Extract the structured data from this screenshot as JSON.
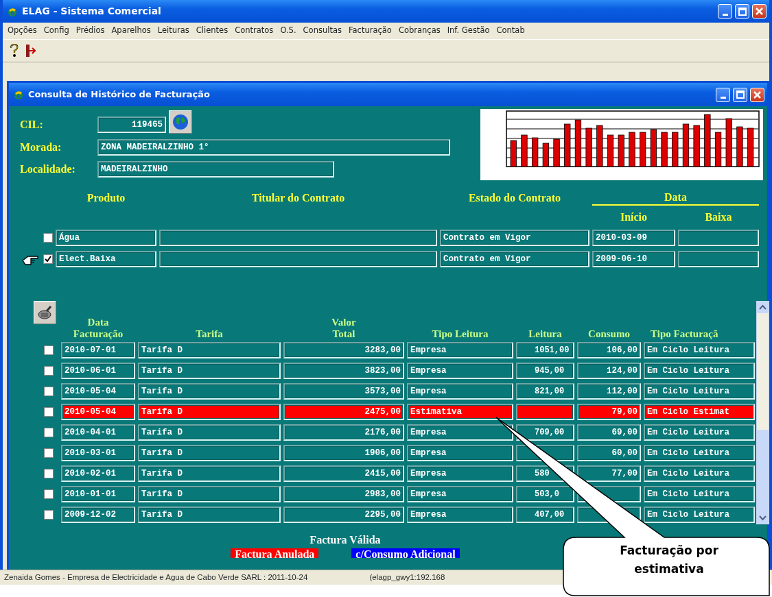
{
  "window": {
    "title": "ELAG - Sistema Comercial"
  },
  "menu": [
    "Opções",
    "Config",
    "Prédios",
    "Aparelhos",
    "Leituras",
    "Clientes",
    "Contratos",
    "O.S.",
    "Consultas",
    "Facturação",
    "Cobranças",
    "Inf. Gestão",
    "Contab"
  ],
  "child_window": {
    "title": "Consulta de Histórico de Facturação",
    "fields": [
      {
        "label": "CIL:",
        "value": "119465"
      },
      {
        "label": "Morada:",
        "value": "ZONA MADEIRALZINHO 1°"
      },
      {
        "label": "Localidade:",
        "value": "MADEIRALZINHO"
      }
    ],
    "contracts": {
      "columns": [
        "Produto",
        "Titular do Contrato",
        "Estado do Contrato"
      ],
      "date_group": "Data",
      "date_columns": [
        "Início",
        "Baixa"
      ],
      "rows": [
        {
          "checked": false,
          "pointer": false,
          "product": "Água",
          "state": "Contrato em Vigor",
          "start": "2010-03-09"
        },
        {
          "checked": true,
          "pointer": true,
          "product": "Elect.Baixa",
          "state": "Contrato em Vigor",
          "start": "2009-06-10"
        }
      ]
    },
    "billing": {
      "columns": [
        "Data\nFacturação",
        "Tarifa",
        "Valor\nTotal",
        "Tipo Leitura",
        "Leitura",
        "Consumo",
        "Tipo Facturaçã"
      ],
      "rows": [
        {
          "checked": false,
          "kind": "valid",
          "date": "2010-07-01",
          "tariff": "Tarifa D",
          "total": "3283,00",
          "reading_type": "Empresa",
          "reading": "1051,00",
          "consumption": "106,00",
          "billing_type": "Em Ciclo Leitura"
        },
        {
          "checked": false,
          "kind": "valid",
          "date": "2010-06-01",
          "tariff": "Tarifa D",
          "total": "3823,00",
          "reading_type": "Empresa",
          "reading": "945,00",
          "consumption": "124,00",
          "billing_type": "Em Ciclo Leitura"
        },
        {
          "checked": false,
          "kind": "valid",
          "date": "2010-05-04",
          "tariff": "Tarifa D",
          "total": "3573,00",
          "reading_type": "Empresa",
          "reading": "821,00",
          "consumption": "112,00",
          "billing_type": "Em Ciclo Leitura"
        },
        {
          "checked": false,
          "kind": "annulled",
          "date": "2010-05-04",
          "tariff": "Tarifa D",
          "total": "2475,00",
          "reading_type": "Estimativa",
          "consumption": "79,00",
          "billing_type": "Em Ciclo Estimat"
        },
        {
          "checked": false,
          "kind": "valid",
          "date": "2010-04-01",
          "tariff": "Tarifa D",
          "total": "2176,00",
          "reading_type": "Empresa",
          "reading": "709,00",
          "consumption": "69,00",
          "billing_type": "Em Ciclo Leitura"
        },
        {
          "checked": false,
          "kind": "valid",
          "date": "2010-03-01",
          "tariff": "Tarifa D",
          "total": "1906,00",
          "reading_type": "Empresa",
          "consumption": "60,00",
          "billing_type": "Em Ciclo Leitura"
        },
        {
          "checked": false,
          "kind": "valid",
          "date": "2010-02-01",
          "tariff": "Tarifa D",
          "total": "2415,00",
          "reading_type": "Empresa",
          "reading": "580",
          "consumption": "77,00",
          "billing_type": "Em Ciclo Leitura"
        },
        {
          "checked": false,
          "kind": "valid",
          "date": "2010-01-01",
          "tariff": "Tarifa D",
          "total": "2983,00",
          "reading_type": "Empresa",
          "reading": "503,0",
          "billing_type": "Em Ciclo Leitura"
        },
        {
          "checked": false,
          "kind": "valid",
          "date": "2009-12-02",
          "tariff": "Tarifa D",
          "total": "2295,00",
          "reading_type": "Empresa",
          "reading": "407,00",
          "billing_type": "Em Ciclo Leitura"
        }
      ]
    },
    "legend": [
      {
        "kind": "valid",
        "label": "Factura Válida"
      },
      {
        "kind": "annulled",
        "label": "Factura Anulada"
      },
      {
        "kind": "extra",
        "label": "c/Consumo Adicional"
      }
    ]
  },
  "status_bar": [
    "Zenaida Gomes - Empresa de Electricidade e Agua de Cabo Verde SARL : 2011-10-24",
    "(elagp_gwy1:192.168"
  ],
  "callout": {
    "text": "Facturação por estimativa"
  }
}
